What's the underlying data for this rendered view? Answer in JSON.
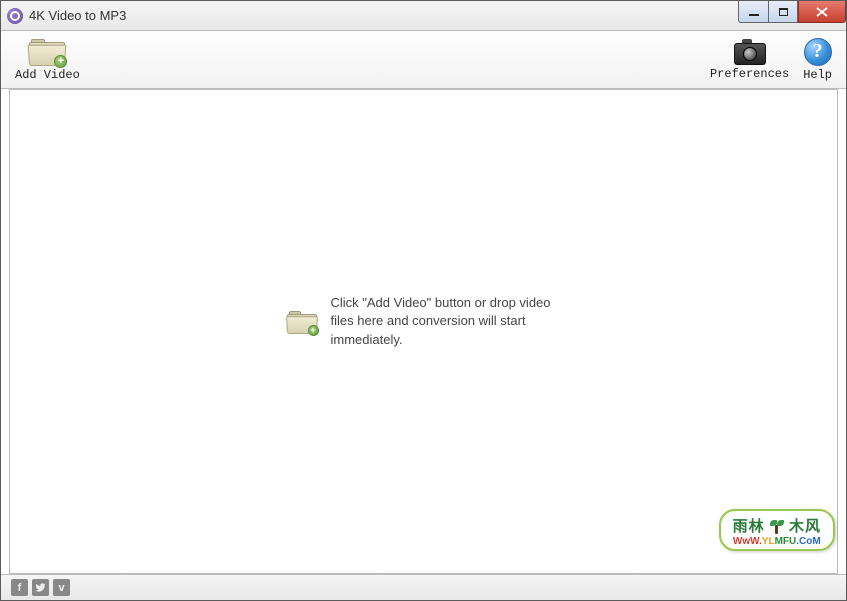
{
  "window": {
    "title": "4K Video to MP3"
  },
  "toolbar": {
    "add_video_label": "Add Video",
    "preferences_label": "Preferences",
    "help_label": "Help",
    "help_glyph": "?"
  },
  "main": {
    "drop_hint": "Click \"Add Video\" button or drop video files here and conversion will start immediately."
  },
  "footer": {
    "social": {
      "facebook": "f",
      "vimeo": "v"
    }
  },
  "watermark": {
    "line1_left": "雨林",
    "line1_right": "木风",
    "line2": {
      "p1": "WwW.",
      "p2": "YL",
      "p3": "MFU",
      "p4": ".CoM"
    }
  }
}
